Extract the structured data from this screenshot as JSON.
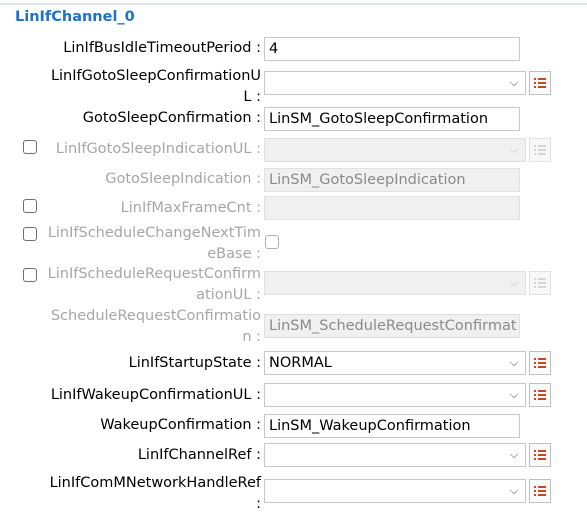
{
  "section_title": "LinIfChannel_0",
  "fields": {
    "bus_idle_timeout": {
      "label": "LinIfBusIdleTimeoutPeriod :",
      "value": "4"
    },
    "goto_sleep_conf_ul": {
      "label": "LinIfGotoSleepConfirmationUL :",
      "value": ""
    },
    "goto_sleep_confirmation": {
      "label": "GotoSleepConfirmation :",
      "value": "LinSM_GotoSleepConfirmation"
    },
    "goto_sleep_indication_ul": {
      "label": "LinIfGotoSleepIndicationUL :",
      "value": "",
      "checked": false
    },
    "goto_sleep_indication": {
      "label": "GotoSleepIndication :",
      "value": "LinSM_GotoSleepIndication"
    },
    "max_frame_cnt": {
      "label": "LinIfMaxFrameCnt :",
      "value": "",
      "checked": false
    },
    "schedule_change_next_timebase": {
      "label": "LinIfScheduleChangeNextTimeBase :",
      "checked": false,
      "value_checked": false
    },
    "schedule_request_conf_ul": {
      "label": "LinIfScheduleRequestConfirmationUL :",
      "value": "",
      "checked": false
    },
    "schedule_request_confirmation": {
      "label": "ScheduleRequestConfirmation :",
      "value": "LinSM_ScheduleRequestConfirmat"
    },
    "startup_state": {
      "label": "LinIfStartupState :",
      "value": "NORMAL"
    },
    "wakeup_conf_ul": {
      "label": "LinIfWakeupConfirmationUL :",
      "value": ""
    },
    "wakeup_confirmation": {
      "label": "WakeupConfirmation :",
      "value": "LinSM_WakeupConfirmation"
    },
    "channel_ref": {
      "label": "LinIfChannelRef :",
      "value": ""
    },
    "comm_network_handle_ref": {
      "label": "LinIfComMNetworkHandleRef :",
      "value": ""
    }
  },
  "icons": {
    "dropdown": "chevron-down-icon",
    "list": "list-icon"
  },
  "colors": {
    "title": "#1e72c8",
    "list_icon": "#c44a1c",
    "disabled_text": "#a6a6a6"
  }
}
